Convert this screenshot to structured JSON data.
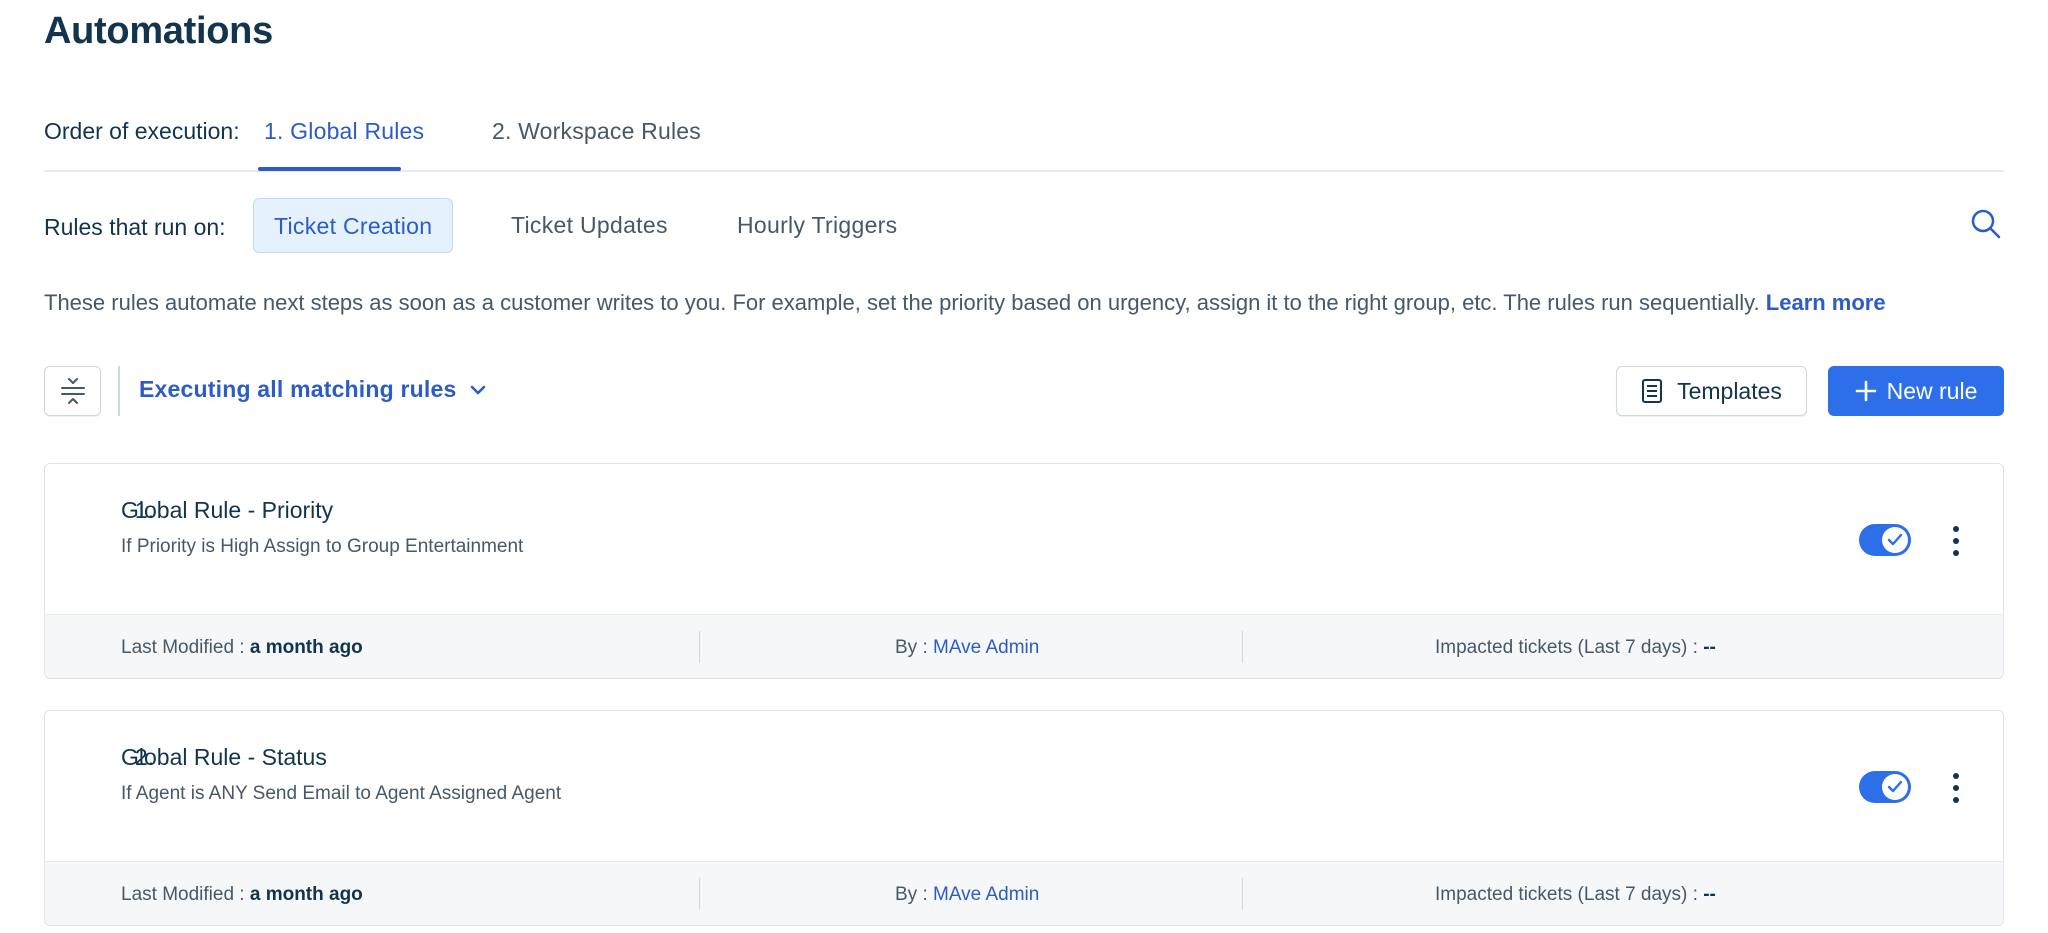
{
  "page": {
    "title": "Automations"
  },
  "execution": {
    "label": "Order of execution:",
    "tabs": [
      {
        "label": "1. Global Rules",
        "active": true
      },
      {
        "label": "2. Workspace Rules",
        "active": false
      }
    ]
  },
  "run_on": {
    "label": "Rules that run on:",
    "chips": [
      {
        "label": "Ticket Creation",
        "active": true
      },
      {
        "label": "Ticket Updates",
        "active": false
      },
      {
        "label": "Hourly Triggers",
        "active": false
      }
    ],
    "search_icon": "search-icon"
  },
  "description": {
    "text": "These rules automate next steps as soon as a customer writes to you. For example, set the priority based on urgency, assign it to the right group, etc. The rules run sequentially.",
    "link": "Learn more"
  },
  "toolbar": {
    "filter_icon": "sort-filter-icon",
    "execution_mode": "Executing all matching rules",
    "templates_label": "Templates",
    "new_rule_label": "New rule"
  },
  "rules": [
    {
      "number": "1.",
      "name": "Global Rule - Priority",
      "condition": "If Priority is High Assign to Group Entertainment",
      "enabled": true,
      "footer": {
        "modified_label": "Last Modified : ",
        "modified_value": "a month ago",
        "by_label": "By : ",
        "by_value": "MAve Admin",
        "impacted_label": "Impacted tickets (Last 7 days) : ",
        "impacted_value": "--"
      }
    },
    {
      "number": "2.",
      "name": "Global Rule - Status",
      "condition": "If Agent is ANY Send Email to Agent Assigned Agent",
      "enabled": true,
      "footer": {
        "modified_label": "Last Modified : ",
        "modified_value": "a month ago",
        "by_label": "By : ",
        "by_value": "MAve Admin",
        "impacted_label": "Impacted tickets (Last 7 days) : ",
        "impacted_value": "--"
      }
    }
  ],
  "colors": {
    "primary": "#2c5cc5",
    "button_primary": "#2c6fe8",
    "text": "#12344d",
    "muted": "#475867",
    "active_chip_bg": "#e5f2fd"
  }
}
